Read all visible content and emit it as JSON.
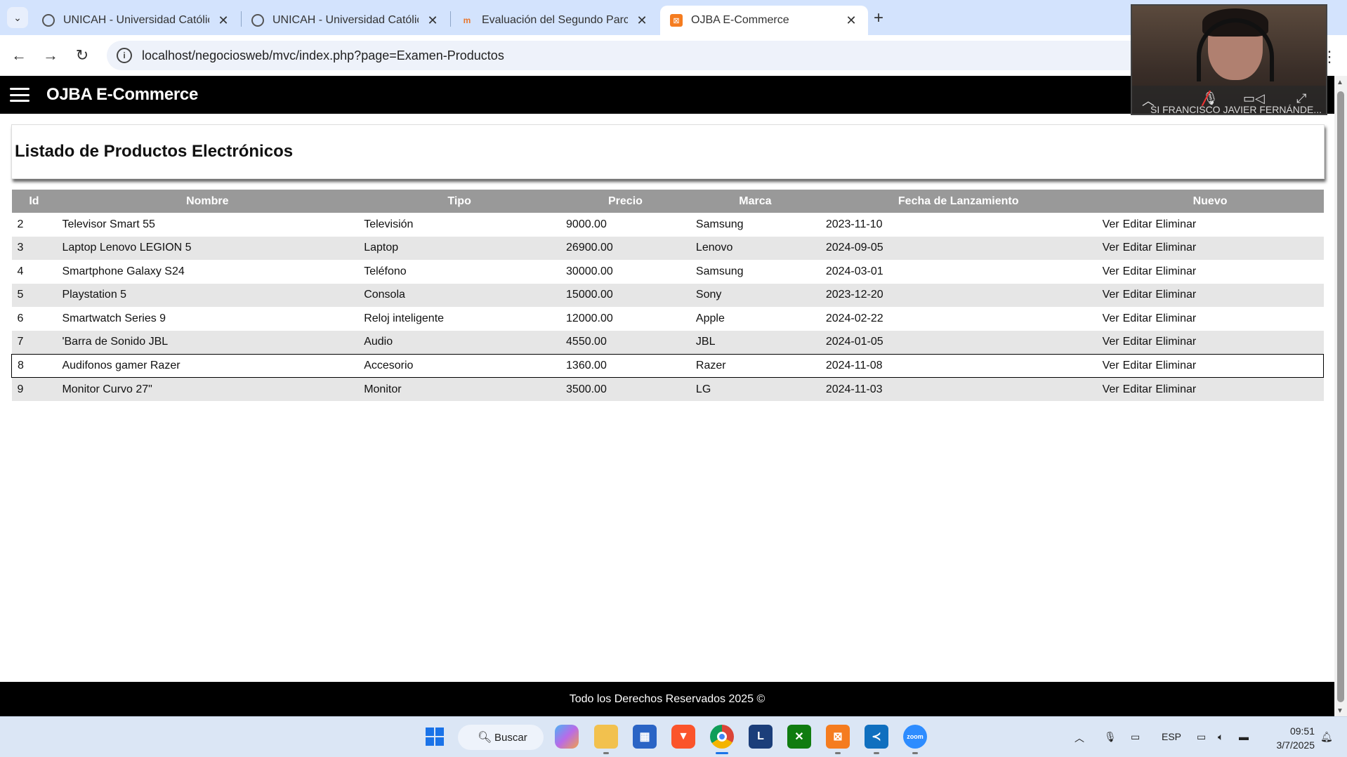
{
  "browser": {
    "tabs": [
      {
        "title": "UNICAH - Universidad Católica",
        "icon": "globe-icon",
        "active": false
      },
      {
        "title": "UNICAH - Universidad Católica",
        "icon": "globe-icon",
        "active": false
      },
      {
        "title": "Evaluación del Segundo Parcial",
        "icon": "moodle-icon",
        "active": false
      },
      {
        "title": "OJBA E-Commerce",
        "icon": "xampp-icon",
        "active": true
      }
    ],
    "url": "localhost/negociosweb/mvc/index.php?page=Examen-Productos"
  },
  "app": {
    "brand": "OJBA E-Commerce",
    "page_title": "Listado de Productos Electrónicos",
    "table": {
      "headers": [
        "Id",
        "Nombre",
        "Tipo",
        "Precio",
        "Marca",
        "Fecha de Lanzamiento",
        "Nuevo"
      ],
      "rows": [
        {
          "id": "2",
          "nombre": "Televisor Smart 55",
          "tipo": "Televisión",
          "precio": "9000.00",
          "marca": "Samsung",
          "fecha": "2023-11-10"
        },
        {
          "id": "3",
          "nombre": "Laptop Lenovo LEGION 5",
          "tipo": "Laptop",
          "precio": "26900.00",
          "marca": "Lenovo",
          "fecha": "2024-09-05"
        },
        {
          "id": "4",
          "nombre": "Smartphone Galaxy S24",
          "tipo": "Teléfono",
          "precio": "30000.00",
          "marca": "Samsung",
          "fecha": "2024-03-01"
        },
        {
          "id": "5",
          "nombre": "Playstation 5",
          "tipo": "Consola",
          "precio": "15000.00",
          "marca": "Sony",
          "fecha": "2023-12-20"
        },
        {
          "id": "6",
          "nombre": "Smartwatch Series 9",
          "tipo": "Reloj inteligente",
          "precio": "12000.00",
          "marca": "Apple",
          "fecha": "2024-02-22"
        },
        {
          "id": "7",
          "nombre": "'Barra de Sonido JBL",
          "tipo": "Audio",
          "precio": "4550.00",
          "marca": "JBL",
          "fecha": "2024-01-05"
        },
        {
          "id": "8",
          "nombre": "Audifonos gamer Razer",
          "tipo": "Accesorio",
          "precio": "1360.00",
          "marca": "Razer",
          "fecha": "2024-11-08"
        },
        {
          "id": "9",
          "nombre": "Monitor Curvo 27\"",
          "tipo": "Monitor",
          "precio": "3500.00",
          "marca": "LG",
          "fecha": "2024-11-03"
        }
      ],
      "actions": [
        "Ver",
        "Editar",
        "Eliminar"
      ]
    },
    "footer": "Todo los Derechos Reservados 2025 ©"
  },
  "video_call": {
    "participant": "SI FRANCISCO JAVIER FERNÁNDE..."
  },
  "taskbar": {
    "search_label": "Buscar",
    "language": "ESP",
    "time": "09:51",
    "date": "3/7/2025"
  },
  "colors": {
    "appbar": "#000000",
    "table_header": "#999999",
    "row_alt": "#e6e6e6",
    "tabstrip": "#d3e3fd"
  }
}
